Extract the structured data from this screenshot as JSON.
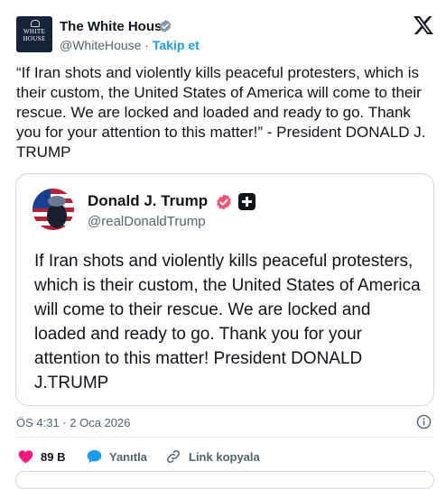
{
  "author": {
    "name": "The White House",
    "handle": "@WhiteHouse",
    "separator": "·",
    "follow_label": "Takip et",
    "avatar_text_line1": "WHITE",
    "avatar_text_line2": "HOUSE"
  },
  "tweet": {
    "text": "“If Iran shots and violently kills peaceful protesters, which is their custom, the United States of America will come to their rescue. We are locked and loaded and ready to go. Thank you for your attention to this matter!” - President DONALD J. TRUMP"
  },
  "quoted": {
    "name": "Donald J. Trump",
    "handle": "@realDonaldTrump",
    "text": "If Iran shots and violently kills peaceful protesters, which is their custom, the United States of America will come to their rescue. We are locked and loaded and ready to go. Thank you for your attention to this matter! President DONALD J.TRUMP"
  },
  "meta": {
    "timestamp": "ÖS 4:31 · 2 Oca 2026"
  },
  "actions": {
    "like_count": "89 B",
    "reply_label": "Yanıtla",
    "copy_link_label": "Link kopyala"
  },
  "colors": {
    "accent": "#1d9bf0",
    "like": "#f91880",
    "reply": "#1d9bf0",
    "gov_badge": "#829aab",
    "verified": "#f4567a",
    "text": "#0f1419",
    "muted": "#536471"
  },
  "icons": {
    "gov_badge": "gray-verified-badge-icon",
    "x_logo": "x-logo-icon",
    "verified": "verified-badge-icon",
    "affiliate": "affiliate-square-icon",
    "info": "info-icon",
    "like": "heart-icon",
    "reply": "speech-bubble-icon",
    "copy": "link-icon"
  }
}
